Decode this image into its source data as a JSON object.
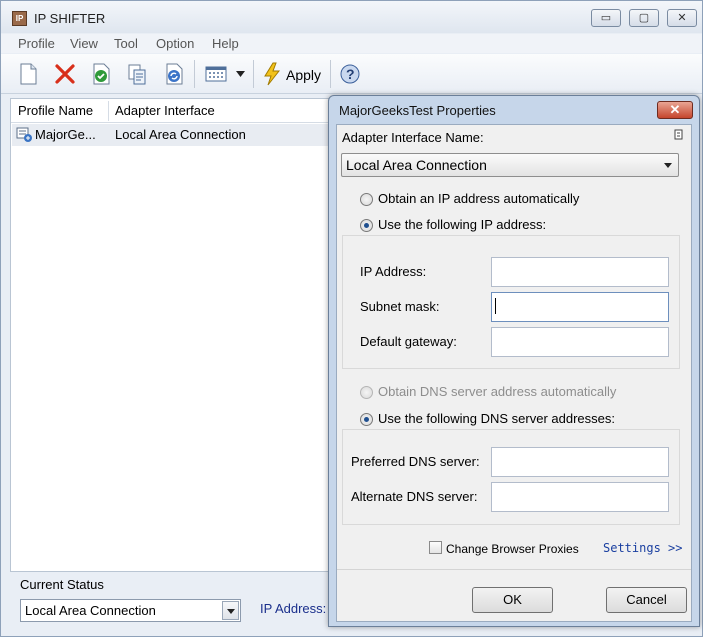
{
  "app": {
    "title": "IP SHIFTER",
    "icon_text": "IP"
  },
  "window_controls": {
    "minimize": "▭",
    "maximize": "▢",
    "close": "✕"
  },
  "menu": [
    "Profile",
    "View",
    "Tool",
    "Option",
    "Help"
  ],
  "toolbar": {
    "buttons": [
      "new-icon",
      "delete-icon",
      "check-icon",
      "copy-icon",
      "refresh-icon",
      "view-icon",
      "lightning-icon",
      "help-icon"
    ],
    "apply_label": "Apply"
  },
  "profile_list": {
    "columns": [
      "Profile Name",
      "Adapter Interface"
    ],
    "rows": [
      {
        "profile_name": "MajorGe...",
        "adapter": "Local Area Connection"
      }
    ]
  },
  "status": {
    "label": "Current Status",
    "selected": "Local Area Connection",
    "ip_label": "IP Address:"
  },
  "dialog": {
    "title": "MajorGeeksTest Properties",
    "close_label": "✕",
    "adapter_label": "Adapter Interface Name:",
    "adapter_value": "Local Area Connection",
    "ip_auto_label": "Obtain an IP address automatically",
    "ip_manual_label": "Use the following IP address:",
    "ip_address_label": "IP  Address:",
    "subnet_label": "Subnet mask:",
    "gateway_label": "Default gateway:",
    "ip_address_value": "",
    "subnet_value": "",
    "gateway_value": "",
    "dns_auto_label": "Obtain DNS server address automatically",
    "dns_manual_label": "Use the following DNS server addresses:",
    "preferred_dns_label": "Preferred DNS server:",
    "alternate_dns_label": "Alternate DNS server:",
    "preferred_dns_value": "",
    "alternate_dns_value": "",
    "proxies_label": "Change Browser Proxies",
    "settings_link": "Settings >>",
    "ok_label": "OK",
    "cancel_label": "Cancel",
    "selection": {
      "ip_mode": "manual",
      "dns_mode": "manual",
      "dns_auto_enabled": false,
      "proxies_checked": false
    }
  },
  "colors": {
    "accent": "#1a3fa0",
    "dialog_frame": "#c6d6ea",
    "close_red": "#c5452c"
  }
}
